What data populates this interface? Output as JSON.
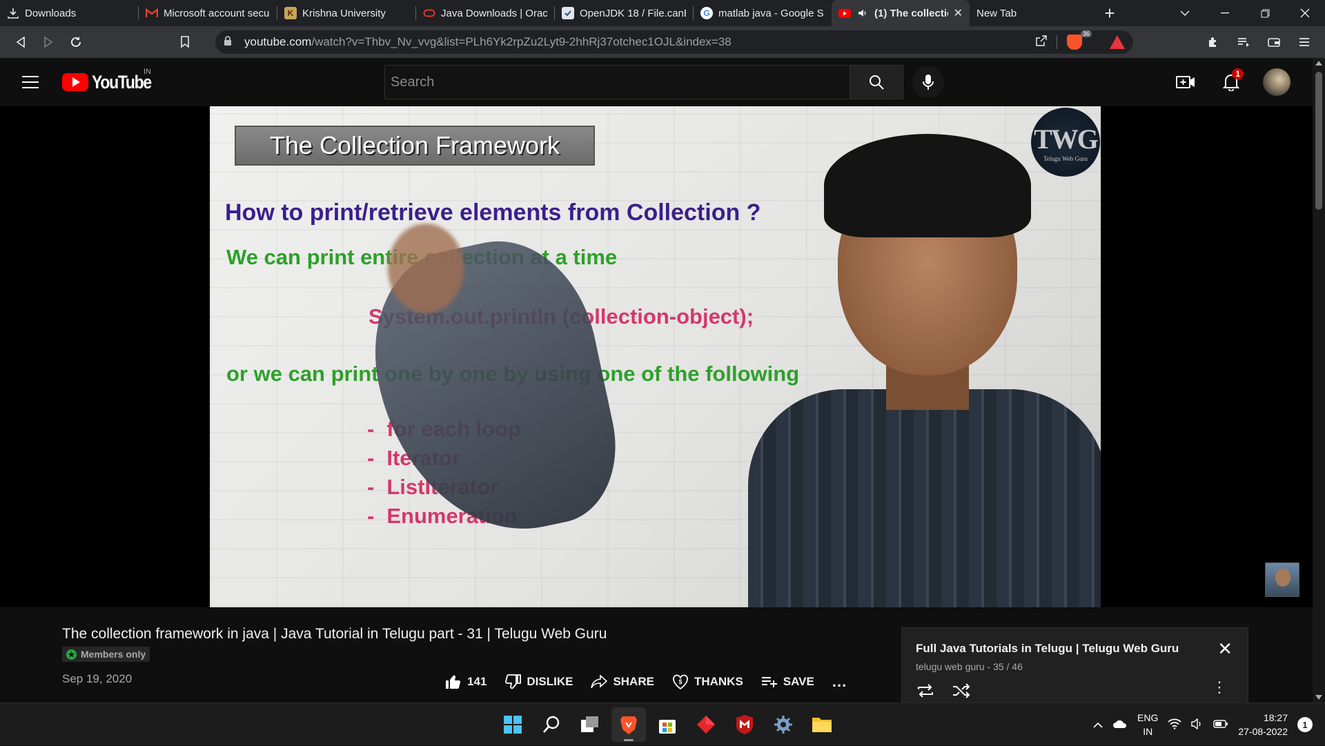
{
  "browser": {
    "tabs": [
      {
        "title": "Downloads",
        "icon": "download-icon",
        "active": false
      },
      {
        "title": "Microsoft account secu",
        "icon": "gmail-icon",
        "active": false
      },
      {
        "title": "Krishna University",
        "icon": "university-icon",
        "active": false
      },
      {
        "title": "Java Downloads | Orac",
        "icon": "oracle-icon",
        "active": false
      },
      {
        "title": "OpenJDK 18 / File.canE",
        "icon": "page-icon",
        "active": false
      },
      {
        "title": "matlab java - Google S",
        "icon": "google-icon",
        "active": false
      },
      {
        "title": "(1) The collectio",
        "icon": "youtube-icon",
        "active": true,
        "audio": true
      },
      {
        "title": "New Tab",
        "icon": "",
        "active": false
      }
    ],
    "new_tab_label": "+",
    "url_host": "youtube.com",
    "url_path": "/watch?v=Thbv_Nv_vvg&list=PLh6Yk2rpZu2Lyt9-2hhRj37otchec1OJL&index=38",
    "brave_shield_count": "36"
  },
  "youtube": {
    "logo_text": "YouTube",
    "country_code": "IN",
    "search_placeholder": "Search",
    "notification_count": "1"
  },
  "video": {
    "slide": {
      "title": "The Collection Framework",
      "question": "How to print/retrieve elements from Collection ?",
      "line1": "We can print entire collection at a time",
      "code": "System.out.println (collection-object);",
      "line3": "or we can print one by one by using one of the following",
      "list": [
        "for each loop",
        "Iterator",
        "ListIterator",
        "Enumeration"
      ],
      "logo_big": "TWG",
      "logo_small": "Telugu Web Guru"
    }
  },
  "meta": {
    "title": "The collection framework in java | Java Tutorial in Telugu part - 31 | Telugu Web Guru",
    "members_badge": "Members only",
    "date": "Sep 19, 2020",
    "like_count": "141",
    "dislike_label": "DISLIKE",
    "share_label": "SHARE",
    "thanks_label": "THANKS",
    "save_label": "SAVE",
    "more_label": "..."
  },
  "playlist": {
    "title": "Full Java Tutorials in Telugu | Telugu Web Guru",
    "subtitle": "telugu web guru - 35 / 46"
  },
  "taskbar": {
    "apps": [
      "windows-start-icon",
      "search-icon",
      "task-view-icon",
      "brave-browser-icon",
      "microsoft-store-icon",
      "redhat-icon",
      "mcafee-icon",
      "settings-icon",
      "file-explorer-icon"
    ],
    "lang_line1": "ENG",
    "lang_line2": "IN",
    "time": "18:27",
    "date": "27-08-2022",
    "notification_count": "1"
  },
  "colors": {
    "youtube_red": "#ff0000",
    "slide_purple": "#3a1f8c",
    "slide_green": "#2ea02b",
    "slide_pink": "#d4386b",
    "brave_orange": "#fb542b"
  }
}
